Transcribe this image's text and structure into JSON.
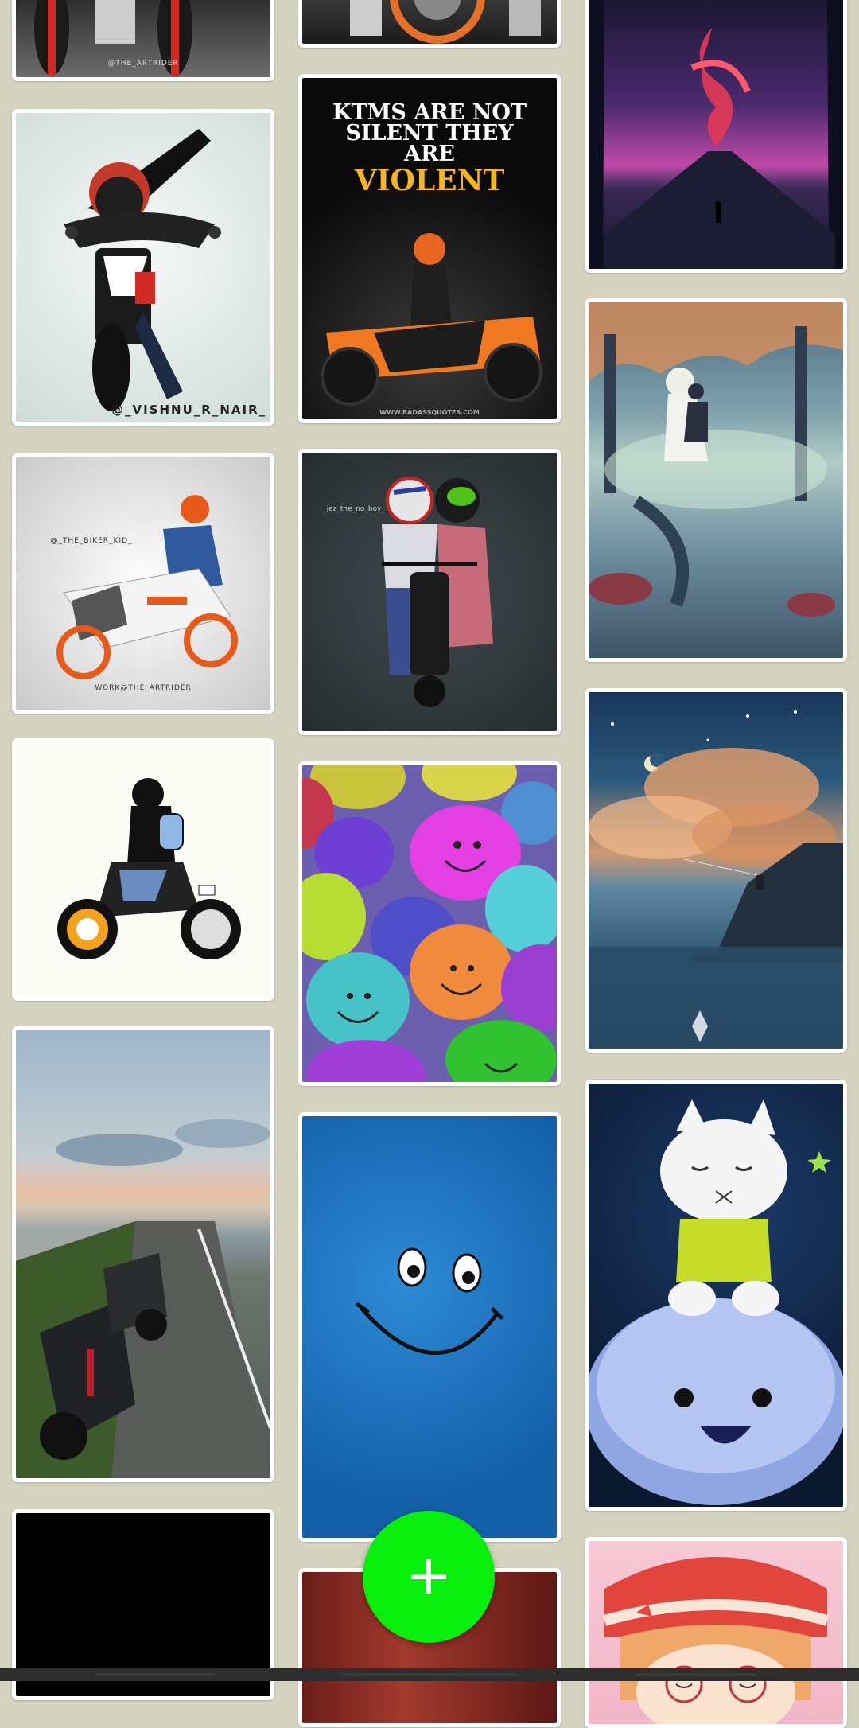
{
  "gallery": {
    "column_1": [
      {
        "kind": "bike-sketch-front-cropped",
        "watermark": "@THE_ARTRIDER"
      },
      {
        "kind": "bike-wheelie-art",
        "watermark": "@_VISHNU_R_NAIR_"
      },
      {
        "kind": "rc-bike-rider-art",
        "watermark_top": "@_THE_BIKER_KID_",
        "watermark_bottom": "WORK@THE_ARTRIDER"
      },
      {
        "kind": "rider-with-backpack-art"
      },
      {
        "kind": "bikes-on-road-photo"
      },
      {
        "kind": "black-wallpaper"
      }
    ],
    "column_2": [
      {
        "kind": "bike-wheel-photo-cropped"
      },
      {
        "kind": "ktm-quote-poster",
        "line1": "KTMS ARE NOT",
        "line2": "SILENT THEY",
        "line3": "ARE",
        "line4": "VIOLENT",
        "footer": "WWW.BADASSQUOTES.COM"
      },
      {
        "kind": "couple-on-bike-art",
        "watermark": "_jez_the_no_boy_"
      },
      {
        "kind": "smiley-balls-photo"
      },
      {
        "kind": "blue-smiley-wallpaper"
      },
      {
        "kind": "red-texture-photo"
      }
    ],
    "column_3": [
      {
        "kind": "volcano-night-art"
      },
      {
        "kind": "forest-pond-art"
      },
      {
        "kind": "sky-fisherman-art"
      },
      {
        "kind": "white-cat-on-cloud-3d"
      },
      {
        "kind": "anime-girl-art"
      }
    ]
  },
  "fab": {
    "icon": "plus-icon",
    "color": "#08ef0b"
  }
}
